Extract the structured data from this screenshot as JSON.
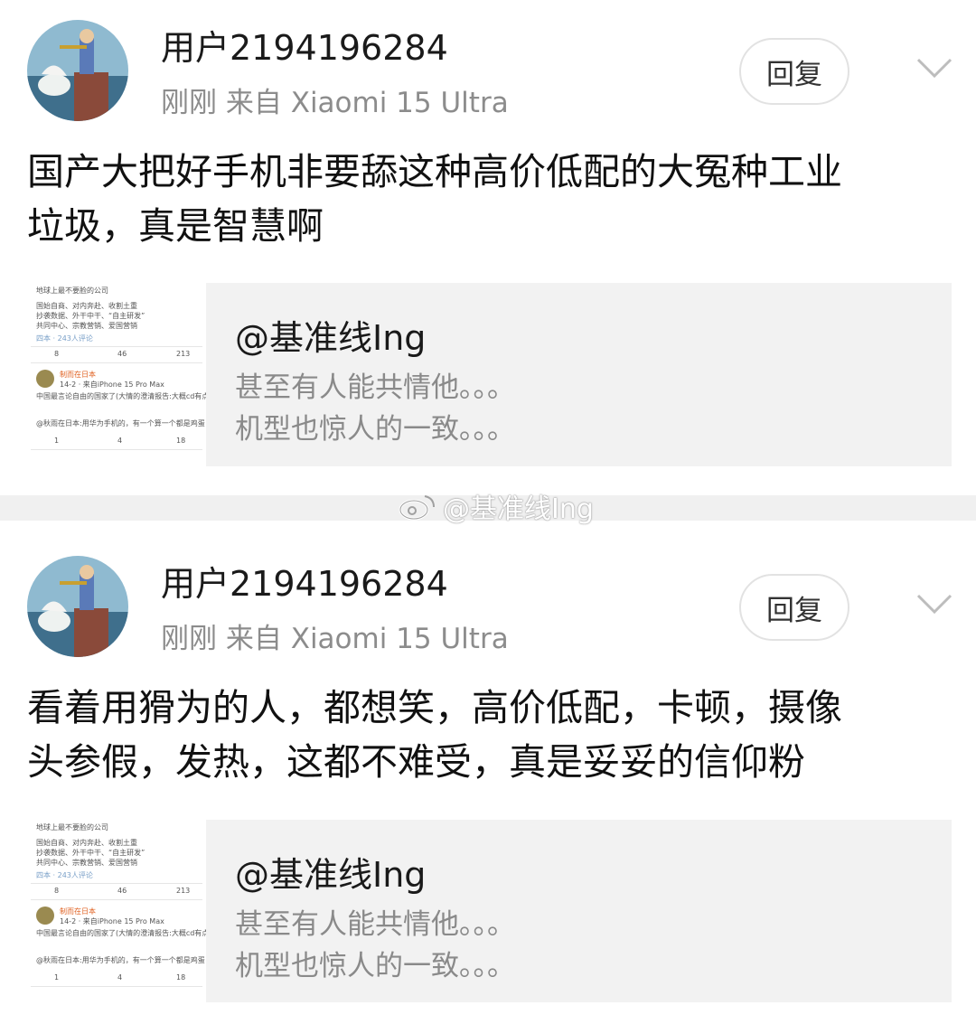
{
  "posts": [
    {
      "username": "用户2194196284",
      "meta": "刚刚  来自 Xiaomi 15 Ultra",
      "reply_label": "回复",
      "body_line1": "国产大把好手机非要舔这种高价低配的大冤种工业",
      "body_line2": "垃圾，真是智慧啊",
      "quote": {
        "author": "@基准线Ing",
        "line1": "甚至有人能共情他。。。",
        "line2": "机型也惊人的一致。。。"
      }
    },
    {
      "username": "用户2194196284",
      "meta": "刚刚  来自 Xiaomi 15 Ultra",
      "reply_label": "回复",
      "body_line1": "看着用猾为的人，都想笑，高价低配，卡顿，摄像",
      "body_line2": "头参假，发热，这都不难受，真是妥妥的信仰粉",
      "quote": {
        "author": "@基准线Ing",
        "line1": "甚至有人能共情他。。。",
        "line2": "机型也惊人的一致。。。"
      }
    }
  ],
  "thumbnail": {
    "title": "地球上最不要脸的公司",
    "l1": "国始自商、对内奔赴、收割土重",
    "l2": "抄袭数据、外干中干、“自主研发”",
    "l3": "共同中心、宗教营销、爱国营销",
    "loc": "四本 · 243人评论",
    "s1": "8",
    "s2": "46",
    "s3": "213",
    "c_name": "制而在日本",
    "c_meta": "14-2 · 来自iPhone 15 Pro Max",
    "c_text": "中国最言论自由的国家了(大情的澄清报告:大概cd有点烦?",
    "c_reply": "@秋雨在日本:用华为手机的，有一个算一个都是鸡蛋",
    "c_s1": "1",
    "c_s2": "4",
    "c_s3": "18"
  },
  "watermark": "@基准线Ing",
  "icons": {
    "chevron": "chevron-down-icon",
    "watermark_logo": "weibo-logo-icon"
  }
}
